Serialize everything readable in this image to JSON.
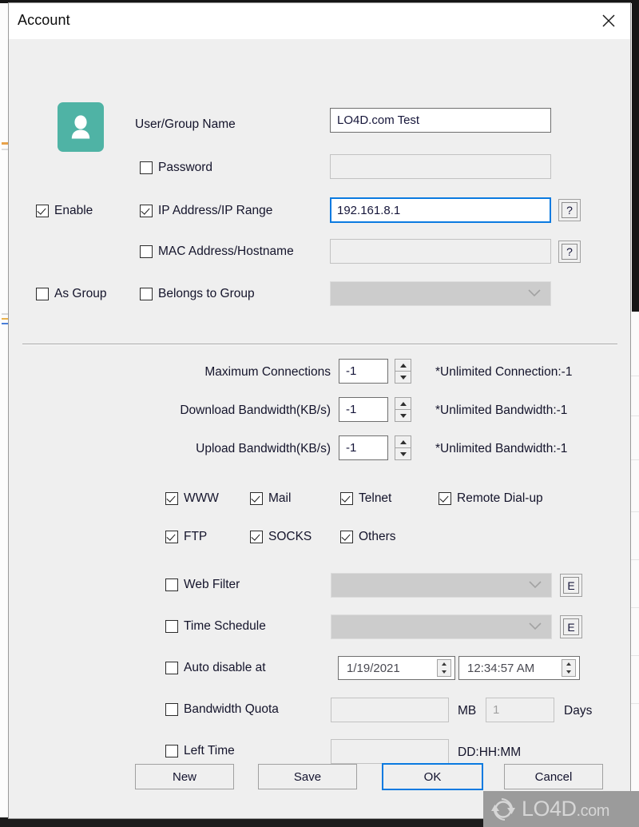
{
  "window": {
    "title": "Account",
    "close_icon": "close-icon"
  },
  "identity": {
    "avatar_icon": "user-avatar-icon",
    "user_group_name_label": "User/Group Name",
    "user_group_name_value": "LO4D.com Test",
    "password_label": "Password",
    "password_value": "",
    "enable_label": "Enable",
    "enable_checked": true,
    "ip_label": "IP Address/IP Range",
    "ip_checked": true,
    "ip_value": "192.161.8.1",
    "ip_help_label": "?",
    "mac_label": "MAC Address/Hostname",
    "mac_checked": false,
    "mac_value": "",
    "mac_help_label": "?",
    "as_group_label": "As Group",
    "as_group_checked": false,
    "belongs_label": "Belongs to Group",
    "belongs_checked": false,
    "belongs_value": ""
  },
  "limits": {
    "max_connections_label": "Maximum Connections",
    "max_connections_value": "-1",
    "max_connections_hint": "*Unlimited Connection:-1",
    "download_label": "Download Bandwidth(KB/s)",
    "download_value": "-1",
    "download_hint": "*Unlimited Bandwidth:-1",
    "upload_label": "Upload Bandwidth(KB/s)",
    "upload_value": "-1",
    "upload_hint": "*Unlimited Bandwidth:-1"
  },
  "services": [
    {
      "label": "WWW",
      "checked": true
    },
    {
      "label": "Mail",
      "checked": true
    },
    {
      "label": "Telnet",
      "checked": true
    },
    {
      "label": "Remote Dial-up",
      "checked": true
    },
    {
      "label": "FTP",
      "checked": true
    },
    {
      "label": "SOCKS",
      "checked": true
    },
    {
      "label": "Others",
      "checked": true
    }
  ],
  "restrictions": {
    "web_filter_label": "Web Filter",
    "web_filter_checked": false,
    "web_filter_value": "",
    "web_filter_edit_label": "E",
    "time_schedule_label": "Time Schedule",
    "time_schedule_checked": false,
    "time_schedule_value": "",
    "time_schedule_edit_label": "E",
    "auto_disable_label": "Auto disable at",
    "auto_disable_checked": false,
    "auto_disable_date": "1/19/2021",
    "auto_disable_time": "12:34:57 AM",
    "bandwidth_quota_label": "Bandwidth Quota",
    "bandwidth_quota_checked": false,
    "bandwidth_quota_value": "",
    "bandwidth_quota_unit": "MB",
    "bandwidth_quota_days_value": "1",
    "bandwidth_quota_days_unit": "Days",
    "left_time_label": "Left Time",
    "left_time_checked": false,
    "left_time_value": "",
    "left_time_format": "DD:HH:MM"
  },
  "footer": {
    "new_label": "New",
    "save_label": "Save",
    "ok_label": "OK",
    "cancel_label": "Cancel"
  },
  "watermark": {
    "name": "LO4D",
    "suffix": ".com"
  },
  "colors": {
    "accent": "#0a7ae0",
    "avatar": "#4fb3a5",
    "dialog_bg": "#efefef",
    "titlebar_bg": "#ffffff",
    "disabled_combo": "#cccccc"
  }
}
